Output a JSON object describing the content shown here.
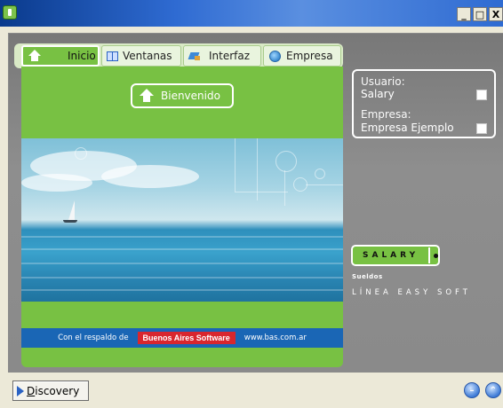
{
  "window": {
    "icon": "app-icon",
    "controls": {
      "minimize": "_",
      "maximize": "□",
      "close": "X"
    }
  },
  "tabs": [
    {
      "label": "Inicio",
      "icon": "home-icon",
      "active": true
    },
    {
      "label": "Ventanas",
      "icon": "window-icon",
      "active": false
    },
    {
      "label": "Interfaz",
      "icon": "interface-icon",
      "active": false
    },
    {
      "label": "Empresa",
      "icon": "globe-icon",
      "active": false
    }
  ],
  "content": {
    "welcome_label": "Bienvenido",
    "footer": {
      "prefix": "Con el respaldo de",
      "company": "Buenos Aires Software",
      "url": "www.bas.com.ar"
    }
  },
  "info": {
    "usuario_label": "Usuario:",
    "usuario_value": "Salary",
    "empresa_label": "Empresa:",
    "empresa_value": "Empresa Ejemplo"
  },
  "branding": {
    "logo_text": "SALARY",
    "sueldos": "Sueldos",
    "linea": "LÍNEA EASY SOFT"
  },
  "bottom": {
    "discovery_label": "Discovery",
    "buttons": [
      "minus-circle-icon",
      "chevron-up-circle-icon"
    ]
  },
  "colors": {
    "accent_green": "#78c143",
    "title_blue": "#2f6bd2",
    "footer_blue": "#1a66b5",
    "bas_red": "#d8262e",
    "panel_gray": "#8a8a8a",
    "window_bg": "#ece9d8"
  }
}
